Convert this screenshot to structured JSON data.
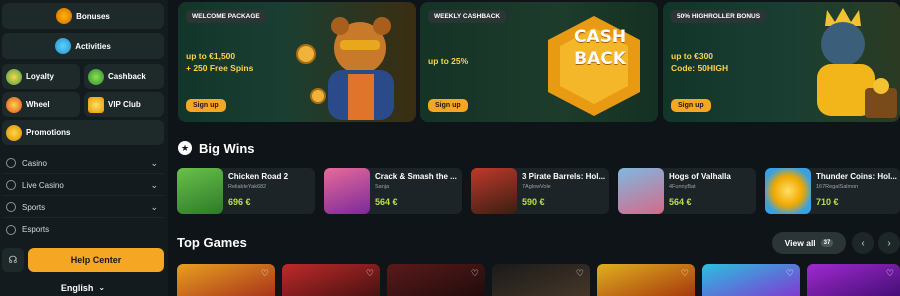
{
  "sidebar": {
    "bonuses": "Bonuses",
    "activities": "Activities",
    "loyalty": "Loyalty",
    "cashback": "Cashback",
    "wheel": "Wheel",
    "vip_club": "VIP Club",
    "promotions": "Promotions",
    "nav": [
      {
        "label": "Casino",
        "icon": "casino-icon"
      },
      {
        "label": "Live Casino",
        "icon": "live-casino-icon"
      },
      {
        "label": "Sports",
        "icon": "sports-icon"
      },
      {
        "label": "Esports",
        "icon": "esports-icon"
      }
    ],
    "help_center": "Help Center",
    "language": "English"
  },
  "promos": [
    {
      "tag": "WELCOME PACKAGE",
      "line1": "up to €1,500",
      "line2": "+ 250 Free Spins",
      "cta": "Sign up"
    },
    {
      "tag": "WEEKLY CASHBACK",
      "line1": "up to 25%",
      "line2": "",
      "cta": "Sign up",
      "art_text": "CASH BACK"
    },
    {
      "tag": "50% HIGHROLLER BONUS",
      "line1": "up to €300",
      "line2": "Code: 50HIGH",
      "cta": "Sign up"
    }
  ],
  "big_wins": {
    "title": "Big Wins",
    "items": [
      {
        "game": "Chicken Road 2",
        "user": "ReliableYak682",
        "amount": "696 €"
      },
      {
        "game": "Crack & Smash the ...",
        "user": "Sanja",
        "amount": "564 €"
      },
      {
        "game": "3 Pirate Barrels: Hol...",
        "user": "7AglowVole",
        "amount": "590 €"
      },
      {
        "game": "Hogs of Valhalla",
        "user": "4FunnyBat",
        "amount": "564 €"
      },
      {
        "game": "Thunder Coins: Hol...",
        "user": "167RegalSalmon",
        "amount": "710 €"
      }
    ]
  },
  "top_games": {
    "title": "Top Games",
    "view_all": "View all",
    "count": "37"
  },
  "colors": {
    "accent": "#f5a623",
    "win_amount": "#b7e04a",
    "background": "#0f1419"
  }
}
